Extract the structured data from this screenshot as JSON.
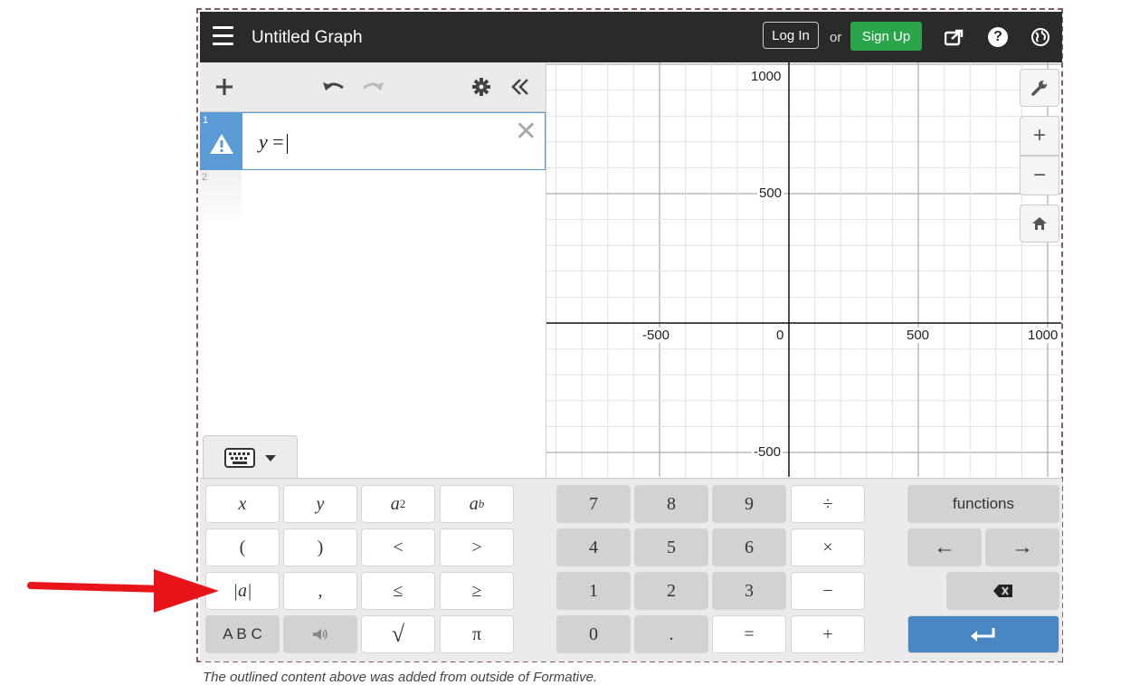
{
  "app": {
    "title": "Untitled Graph",
    "login_label": "Log In",
    "or_label": "or",
    "signup_label": "Sign Up"
  },
  "expressions": [
    {
      "num": "1",
      "latex_var": "y",
      "latex_op": "="
    },
    {
      "num": "2"
    }
  ],
  "graph": {
    "x_ticks": [
      "-500",
      "0",
      "500",
      "1000"
    ],
    "y_ticks": [
      "1000",
      "500",
      "-500"
    ]
  },
  "keypad": {
    "left": [
      [
        "x",
        "y",
        "a2",
        "ab"
      ],
      [
        "(",
        ")",
        "<",
        ">"
      ],
      [
        "|a|",
        ",",
        "≤",
        "≥"
      ],
      [
        "A B C",
        "speaker",
        "√",
        "π"
      ]
    ],
    "num": [
      [
        "7",
        "8",
        "9",
        "÷"
      ],
      [
        "4",
        "5",
        "6",
        "×"
      ],
      [
        "1",
        "2",
        "3",
        "−"
      ],
      [
        "0",
        ".",
        "=",
        "+"
      ]
    ],
    "functions_label": "functions",
    "left_arrow": "←",
    "right_arrow": "→"
  },
  "caption": "The outlined content above was added from outside of Formative.",
  "colors": {
    "accent": "#5b9bd5",
    "signup": "#2aa54b",
    "enter": "#4a85c4",
    "arrow": "#e8141a"
  }
}
